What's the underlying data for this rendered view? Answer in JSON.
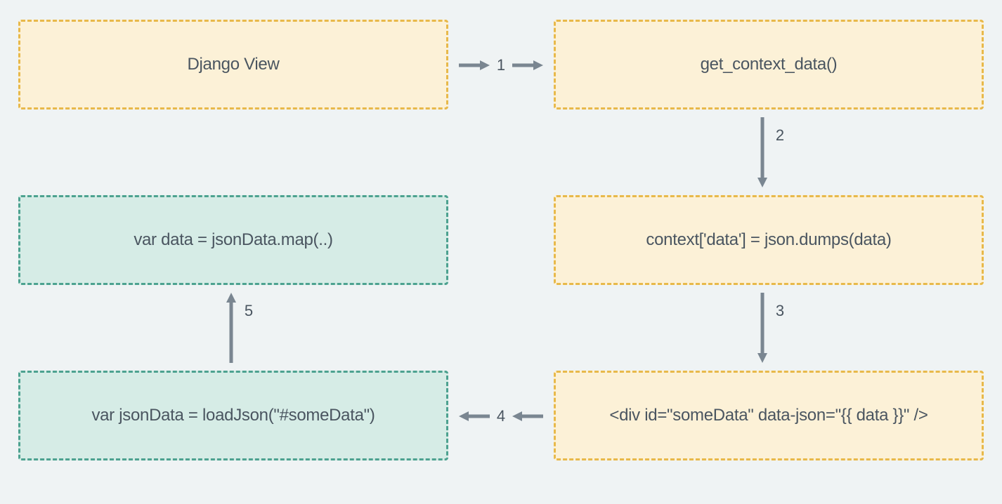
{
  "boxes": {
    "django_view": "Django View",
    "get_context": "get_context_data()",
    "context_dump": "context['data'] = json.dumps(data)",
    "div_template": "<div id=\"someData\" data-json=\"{{ data }}\" />",
    "load_json": "var jsonData = loadJson(\"#someData\")",
    "map_data": "var data = jsonData.map(..)"
  },
  "arrows": {
    "a1": "1",
    "a2": "2",
    "a3": "3",
    "a4": "4",
    "a5": "5"
  },
  "colors": {
    "yellow_fill": "#fcf1d7",
    "yellow_border": "#e8b94a",
    "teal_fill": "#d6ece6",
    "teal_border": "#4da290",
    "arrow": "#7a8691",
    "text": "#4a5560",
    "bg": "#eff3f4"
  }
}
